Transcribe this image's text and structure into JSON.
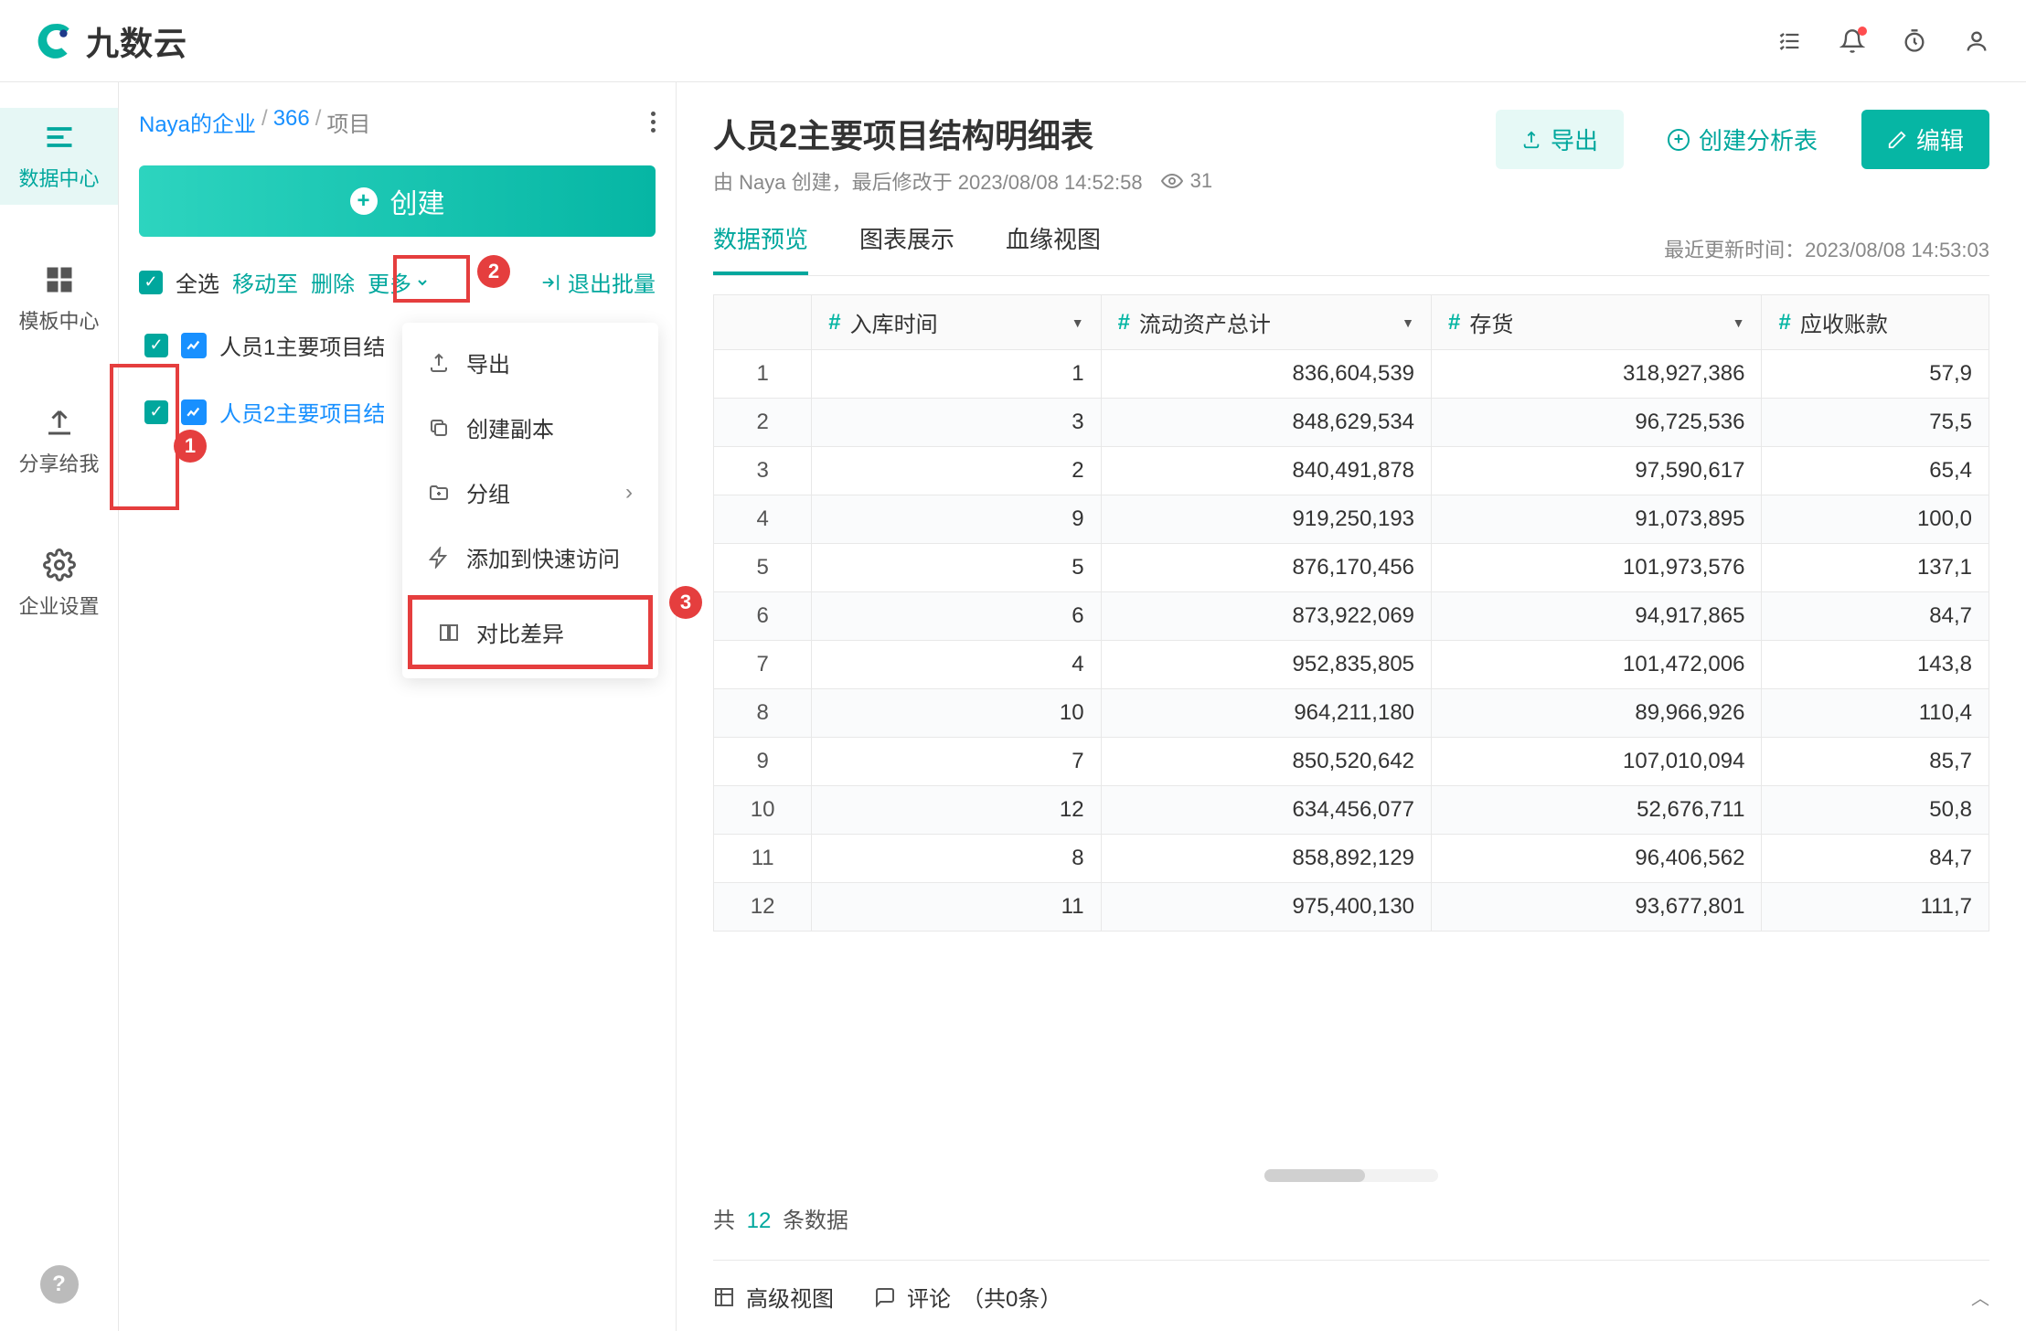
{
  "brand": "九数云",
  "nav": {
    "data_center": "数据中心",
    "template_center": "模板中心",
    "share_to_me": "分享给我",
    "enterprise_settings": "企业设置"
  },
  "breadcrumb": {
    "company": "Naya的企业",
    "folder": "366",
    "current": "项目"
  },
  "create_btn": "创建",
  "toolbar": {
    "select_all": "全选",
    "move_to": "移动至",
    "delete": "删除",
    "more": "更多",
    "exit_batch": "退出批量"
  },
  "dropdown": {
    "export": "导出",
    "copy": "创建副本",
    "group": "分组",
    "quick_access": "添加到快速访问",
    "diff": "对比差异"
  },
  "files": [
    "人员1主要项目结",
    "人员2主要项目结"
  ],
  "page_title": "人员2主要项目结构明细表",
  "meta": {
    "creator_prefix": "由 ",
    "creator": "Naya",
    "created_label": " 创建，最后修改于 ",
    "modified": "2023/08/08 14:52:58",
    "views": "31"
  },
  "actions": {
    "export": "导出",
    "create_analysis": "创建分析表",
    "edit": "编辑"
  },
  "tabs": {
    "preview": "数据预览",
    "chart": "图表展示",
    "lineage": "血缘视图"
  },
  "update_label": "最近更新时间：",
  "update_time": "2023/08/08 14:53:03",
  "columns": [
    "入库时间",
    "流动资产总计",
    "存货",
    "应收账款"
  ],
  "rows": [
    {
      "i": "1",
      "c0": "1",
      "c1": "836,604,539",
      "c2": "318,927,386",
      "c3": "57,9"
    },
    {
      "i": "2",
      "c0": "3",
      "c1": "848,629,534",
      "c2": "96,725,536",
      "c3": "75,5"
    },
    {
      "i": "3",
      "c0": "2",
      "c1": "840,491,878",
      "c2": "97,590,617",
      "c3": "65,4"
    },
    {
      "i": "4",
      "c0": "9",
      "c1": "919,250,193",
      "c2": "91,073,895",
      "c3": "100,0"
    },
    {
      "i": "5",
      "c0": "5",
      "c1": "876,170,456",
      "c2": "101,973,576",
      "c3": "137,1"
    },
    {
      "i": "6",
      "c0": "6",
      "c1": "873,922,069",
      "c2": "94,917,865",
      "c3": "84,7"
    },
    {
      "i": "7",
      "c0": "4",
      "c1": "952,835,805",
      "c2": "101,472,006",
      "c3": "143,8"
    },
    {
      "i": "8",
      "c0": "10",
      "c1": "964,211,180",
      "c2": "89,966,926",
      "c3": "110,4"
    },
    {
      "i": "9",
      "c0": "7",
      "c1": "850,520,642",
      "c2": "107,010,094",
      "c3": "85,7"
    },
    {
      "i": "10",
      "c0": "12",
      "c1": "634,456,077",
      "c2": "52,676,711",
      "c3": "50,8"
    },
    {
      "i": "11",
      "c0": "8",
      "c1": "858,892,129",
      "c2": "96,406,562",
      "c3": "84,7"
    },
    {
      "i": "12",
      "c0": "11",
      "c1": "975,400,130",
      "c2": "93,677,801",
      "c3": "111,7"
    }
  ],
  "footer": {
    "total_prefix": "共",
    "total_count": "12",
    "total_suffix": "条数据",
    "advanced_view": "高级视图",
    "comment": "评论",
    "comment_count": "（共0条）"
  }
}
